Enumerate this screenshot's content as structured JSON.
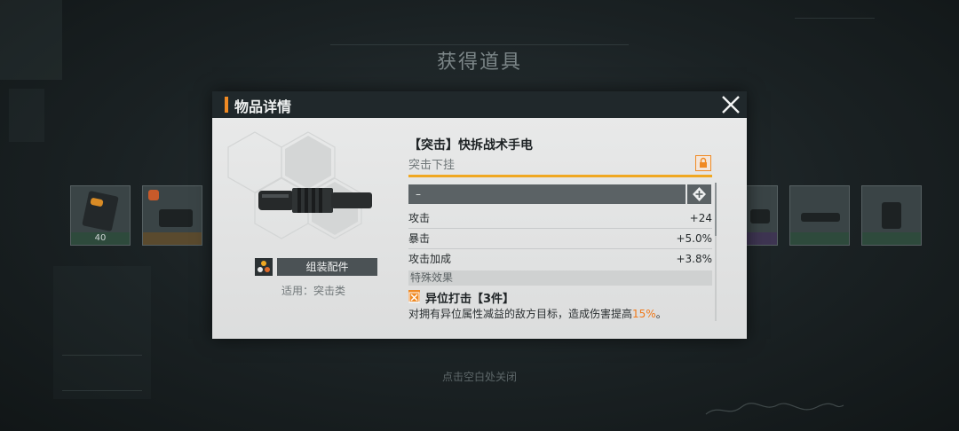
{
  "screen": {
    "title": "获得道具",
    "hint": "点击空白处关闭"
  },
  "background_items": [
    {
      "count": "40",
      "bar": "green"
    },
    {
      "count": "",
      "bar": "orange"
    },
    {
      "count": "",
      "bar": "purple"
    },
    {
      "count": "",
      "bar": "green"
    },
    {
      "count": "",
      "bar": "green"
    }
  ],
  "dialog": {
    "header_title": "物品详情",
    "item": {
      "name": "【突击】快拆战术手电",
      "subtitle": "突击下挂",
      "slot_value": "–",
      "assemble_label": "组装配件",
      "applicable": "适用：突击类"
    },
    "stats": [
      {
        "name": "攻击",
        "value": "+24"
      },
      {
        "name": "暴击",
        "value": "+5.0%"
      },
      {
        "name": "攻击加成",
        "value": "+3.8%"
      }
    ],
    "special": {
      "header": "特殊效果",
      "effect_title": "异位打击【3件】",
      "effect_desc_prefix": "对拥有异位属性减益的敌方目标，造成伤害提高",
      "effect_desc_value": "15%",
      "effect_desc_suffix": "。"
    }
  },
  "colors": {
    "accent": "#f08a24",
    "rarity_line": "#f0a822",
    "highlight": "#f07a1c",
    "header_bg": "#20282b"
  },
  "icons": [
    "close-icon",
    "lock-icon",
    "plus-icon",
    "assemble-icon",
    "effect-icon",
    "flashlight-icon"
  ]
}
